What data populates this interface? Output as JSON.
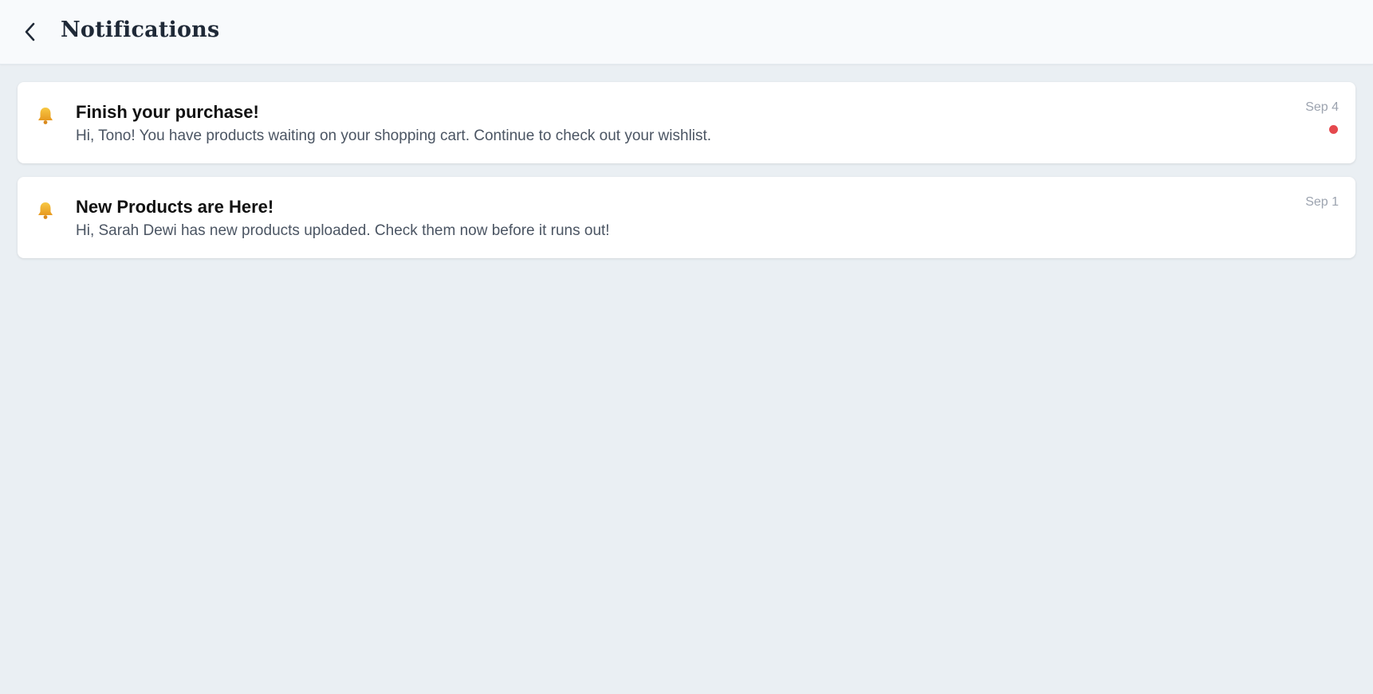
{
  "header": {
    "title": "Notifications",
    "back_icon": "chevron-left-icon"
  },
  "notifications": [
    {
      "icon": "bell-icon",
      "title": "Finish your purchase!",
      "message": "Hi, Tono! You have products waiting on your shopping cart. Continue to check out your wishlist.",
      "date": "Sep 4",
      "unread": true
    },
    {
      "icon": "bell-icon",
      "title": "New Products are Here!",
      "message": "Hi, Sarah Dewi has new products uploaded. Check them now before it runs out!",
      "date": "Sep 1",
      "unread": false
    }
  ],
  "colors": {
    "background": "#eaeff3",
    "header_background": "#f8fafc",
    "unread_dot": "#e5484d",
    "bell": "#f2b431"
  }
}
